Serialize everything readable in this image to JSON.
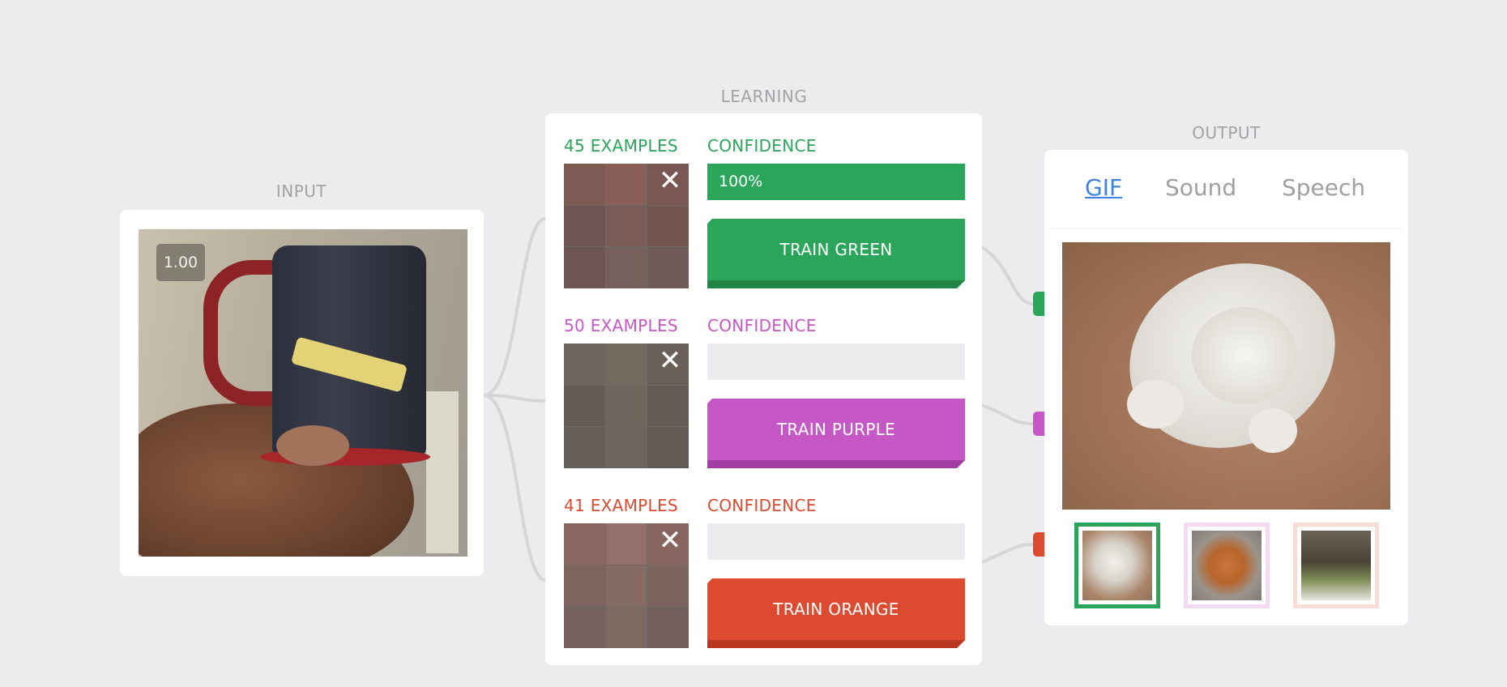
{
  "input": {
    "title": "INPUT",
    "value_badge": "1.00"
  },
  "learning": {
    "title": "LEARNING",
    "classes": [
      {
        "color": "#2aa55a",
        "shadow": "#1f8446",
        "examples": "45 EXAMPLES",
        "confidence_label": "CONFIDENCE",
        "confidence_value": 1.0,
        "confidence_text": "100%",
        "train_label": "TRAIN GREEN",
        "clear_icon": "✕"
      },
      {
        "color": "#c658c6",
        "shadow": "#a23ea3",
        "examples": "50 EXAMPLES",
        "confidence_label": "CONFIDENCE",
        "confidence_value": 0.0,
        "confidence_text": "",
        "train_label": "TRAIN PURPLE",
        "clear_icon": "✕"
      },
      {
        "color": "#dc4a2f",
        "shadow": "#b93620",
        "examples": "41 EXAMPLES",
        "confidence_label": "CONFIDENCE",
        "confidence_value": 0.0,
        "confidence_text": "",
        "train_label": "TRAIN ORANGE",
        "clear_icon": "✕"
      }
    ]
  },
  "output": {
    "title": "OUTPUT",
    "tabs": [
      {
        "label": "GIF",
        "active": true
      },
      {
        "label": "Sound",
        "active": false
      },
      {
        "label": "Speech",
        "active": false
      }
    ],
    "gif_thumbs": [
      {
        "name": "gif-thumb-cat",
        "border": "#2aa55a"
      },
      {
        "name": "gif-thumb-dog",
        "border": "#f3d9f2"
      },
      {
        "name": "gif-thumb-bunny",
        "border": "#f8dcd6"
      }
    ]
  }
}
